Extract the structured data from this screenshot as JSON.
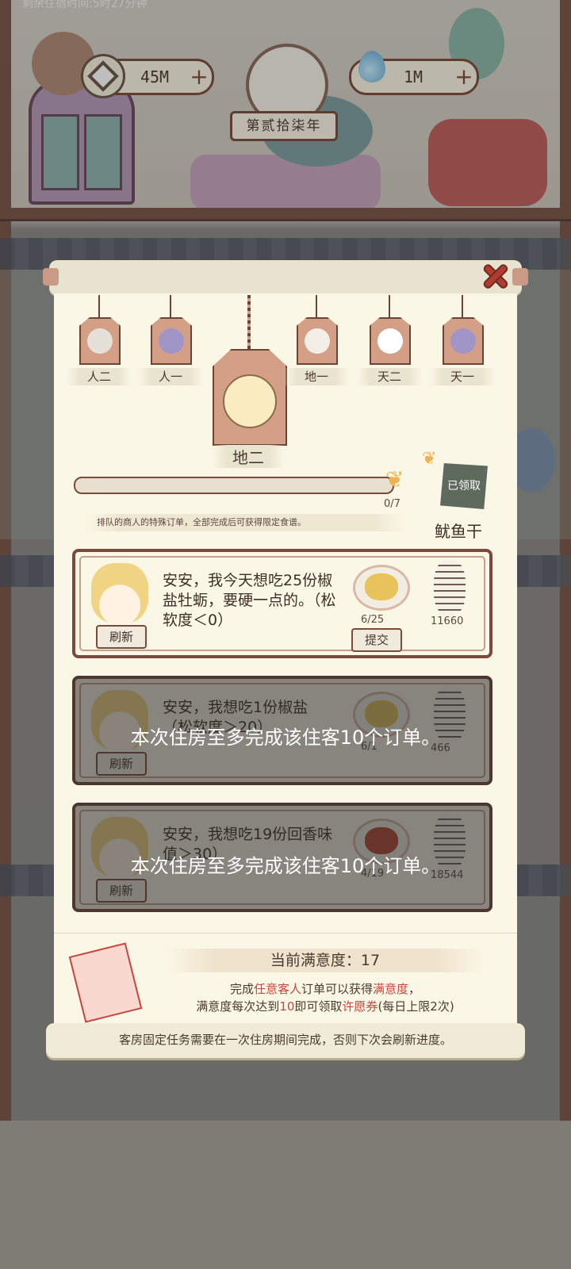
{
  "top_bar": {
    "timer_text": "剩余住宿时间:5时27分钟",
    "coins": "45M",
    "essence": "1M",
    "plus": "+",
    "year": "第贰拾柒年"
  },
  "tabs": [
    {
      "label": "人二"
    },
    {
      "label": "人一"
    },
    {
      "label": "地一"
    },
    {
      "label": "天二"
    },
    {
      "label": "天一"
    }
  ],
  "selected_tab": {
    "label": "地二"
  },
  "progress": {
    "count": "0/7",
    "fraction": 0,
    "claimed": "已领取",
    "reward": "鱿鱼干",
    "description": "排队的商人的特殊订单，全部完成后可获得限定食谱。"
  },
  "orders": [
    {
      "message": "安安，我今天想吃25份椒盐牡蛎，要硬一点的。（松软度＜0）",
      "refresh": "刷新",
      "dish_count": "6/25",
      "submit": "提交",
      "reward_count": "11660",
      "dish_color": "#e8c25a",
      "locked": false
    },
    {
      "message": "安安，我想吃1份椒盐（松软度＞20）",
      "refresh": "刷新",
      "dish_count": "6/1",
      "reward_count": "466",
      "dish_color": "#e2c05c",
      "locked": true,
      "lock_text": "本次住房至多完成该住客10个订单。"
    },
    {
      "message": "安安，我想吃19份回香味值＞30）",
      "refresh": "刷新",
      "dish_count": "4/19",
      "reward_count": "18544",
      "dish_color": "#b8452e",
      "locked": true,
      "lock_text": "本次住房至多完成该住客10个订单。"
    }
  ],
  "satisfaction": {
    "label": "当前满意度：17",
    "line1_pre": "完成",
    "line1_hl1": "任意客人",
    "line1_mid": "订单可以获得",
    "line1_hl2": "满意度",
    "line1_post": "，",
    "line2_pre": "满意度每次达到",
    "line2_hl1": "10",
    "line2_mid": "即可领取",
    "line2_hl2": "许愿券",
    "line2_post": "(每日上限2次)"
  },
  "footer_tip": "客房固定任务需要在一次住房期间完成，否则下次会刷新进度。",
  "colors": {
    "accent": "#7a4b3a",
    "highlight": "#c7463d",
    "progress_fill": "#b96c5f"
  }
}
